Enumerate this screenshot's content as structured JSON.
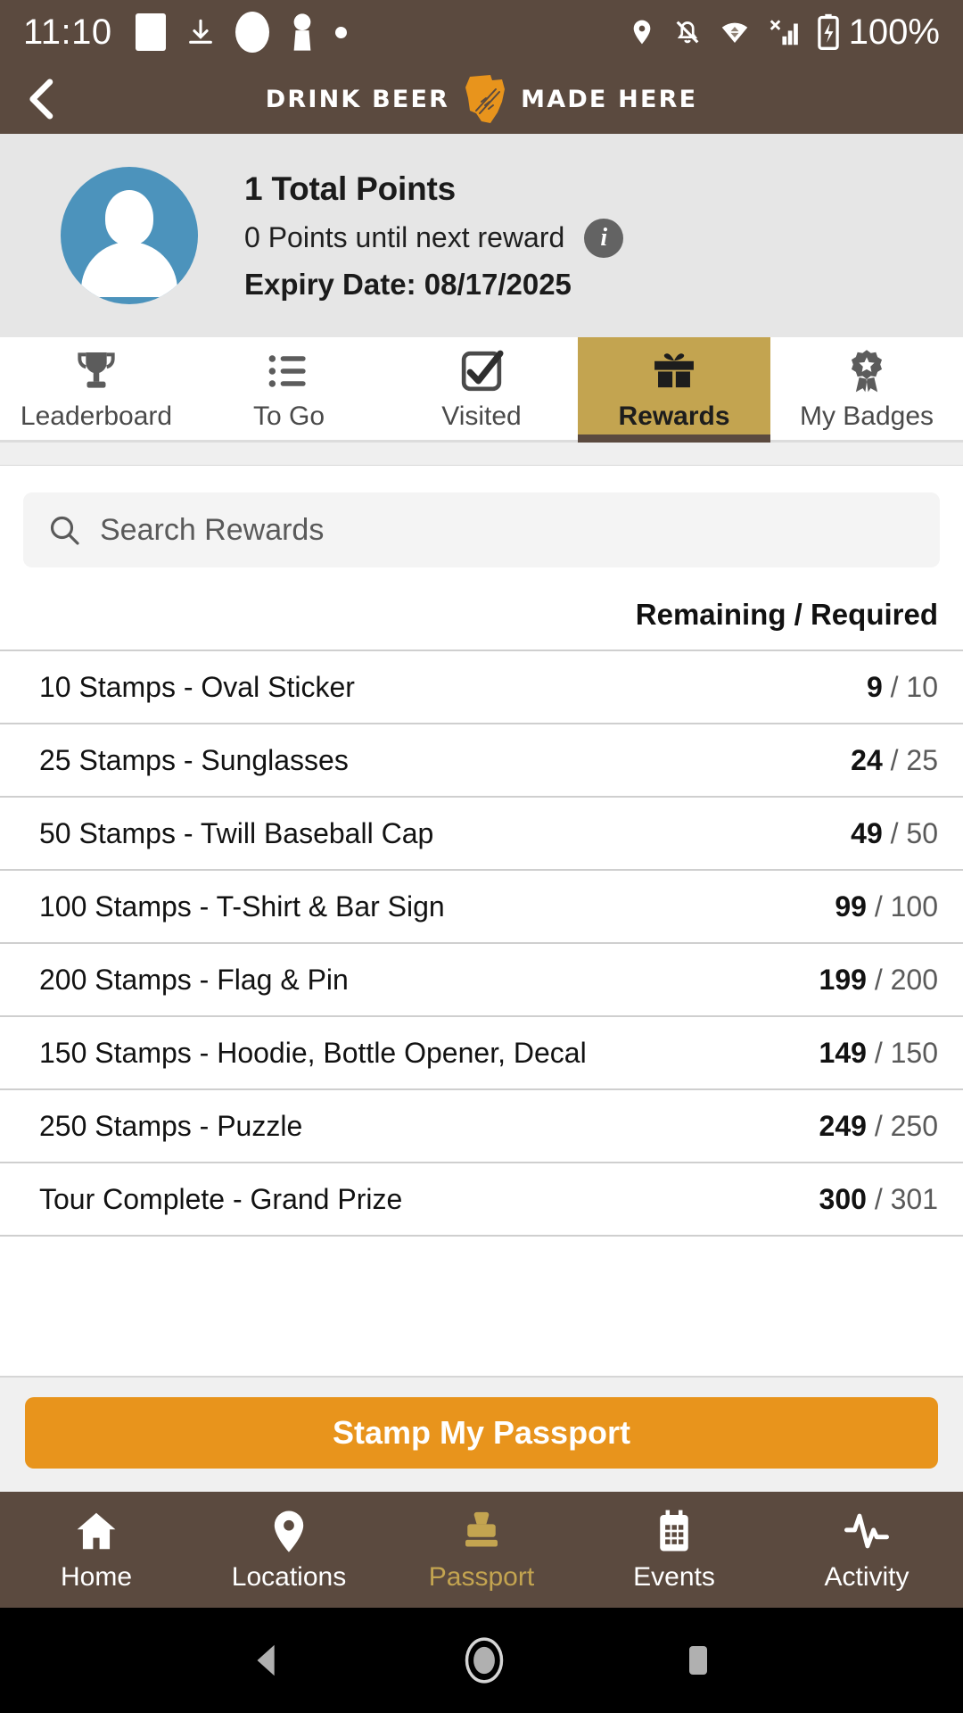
{
  "status_bar": {
    "time": "11:10",
    "battery_percent": "100%",
    "left_icons": [
      "square-icon",
      "download-icon",
      "oval-icon",
      "keyhole-icon",
      "dot-icon"
    ],
    "right_icons": [
      "location-pin-icon",
      "notifications-off-icon",
      "wifi-icon",
      "signal-bars-icon",
      "battery-charging-icon"
    ]
  },
  "header": {
    "back_label": "Back",
    "logo_left": "DRINK BEER",
    "logo_right": "MADE HERE",
    "logo_icon": "ohio-wheat-logo-icon",
    "bg_color": "#5B4A3F"
  },
  "profile": {
    "avatar_icon": "user-avatar-icon",
    "total_points": "1 Total Points",
    "until_next_reward": "0 Points until next reward",
    "info_icon_label": "i",
    "expiry": "Expiry Date: 08/17/2025"
  },
  "tabs": {
    "active": "Rewards",
    "active_bg": "#C3A450",
    "items": [
      {
        "label": "Leaderboard",
        "icon": "trophy-icon",
        "active": false
      },
      {
        "label": "To Go",
        "icon": "list-icon",
        "active": false
      },
      {
        "label": "Visited",
        "icon": "checkbox-check-icon",
        "active": false
      },
      {
        "label": "Rewards",
        "icon": "gift-icon",
        "active": true
      },
      {
        "label": "My Badges",
        "icon": "badge-ribbon-icon",
        "active": false
      }
    ]
  },
  "search": {
    "placeholder": "Search Rewards",
    "value": "",
    "icon": "search-icon"
  },
  "rewards_table": {
    "column_header": "Remaining / Required",
    "rows": [
      {
        "name": "10 Stamps - Oval Sticker",
        "remaining": "9",
        "required": "10"
      },
      {
        "name": "25 Stamps - Sunglasses",
        "remaining": "24",
        "required": "25"
      },
      {
        "name": "50 Stamps - Twill Baseball Cap",
        "remaining": "49",
        "required": "50"
      },
      {
        "name": "100 Stamps - T-Shirt & Bar Sign",
        "remaining": "99",
        "required": "100"
      },
      {
        "name": "200 Stamps - Flag & Pin",
        "remaining": "199",
        "required": "200"
      },
      {
        "name": "150 Stamps - Hoodie, Bottle Opener, Decal",
        "remaining": "149",
        "required": "150"
      },
      {
        "name": "250 Stamps - Puzzle",
        "remaining": "249",
        "required": "250"
      },
      {
        "name": "Tour Complete - Grand Prize",
        "remaining": "300",
        "required": "301"
      }
    ]
  },
  "cta": {
    "label": "Stamp My Passport",
    "color": "#E8941C"
  },
  "bottom_nav": {
    "active": "Passport",
    "active_color": "#C3A450",
    "items": [
      {
        "label": "Home",
        "icon": "home-icon",
        "active": false
      },
      {
        "label": "Locations",
        "icon": "map-pin-icon",
        "active": false
      },
      {
        "label": "Passport",
        "icon": "stamp-icon",
        "active": true
      },
      {
        "label": "Events",
        "icon": "calendar-icon",
        "active": false
      },
      {
        "label": "Activity",
        "icon": "pulse-icon",
        "active": false
      }
    ]
  },
  "android_nav": {
    "items": [
      {
        "icon": "android-back-icon"
      },
      {
        "icon": "android-home-icon"
      },
      {
        "icon": "android-recents-icon"
      }
    ]
  }
}
